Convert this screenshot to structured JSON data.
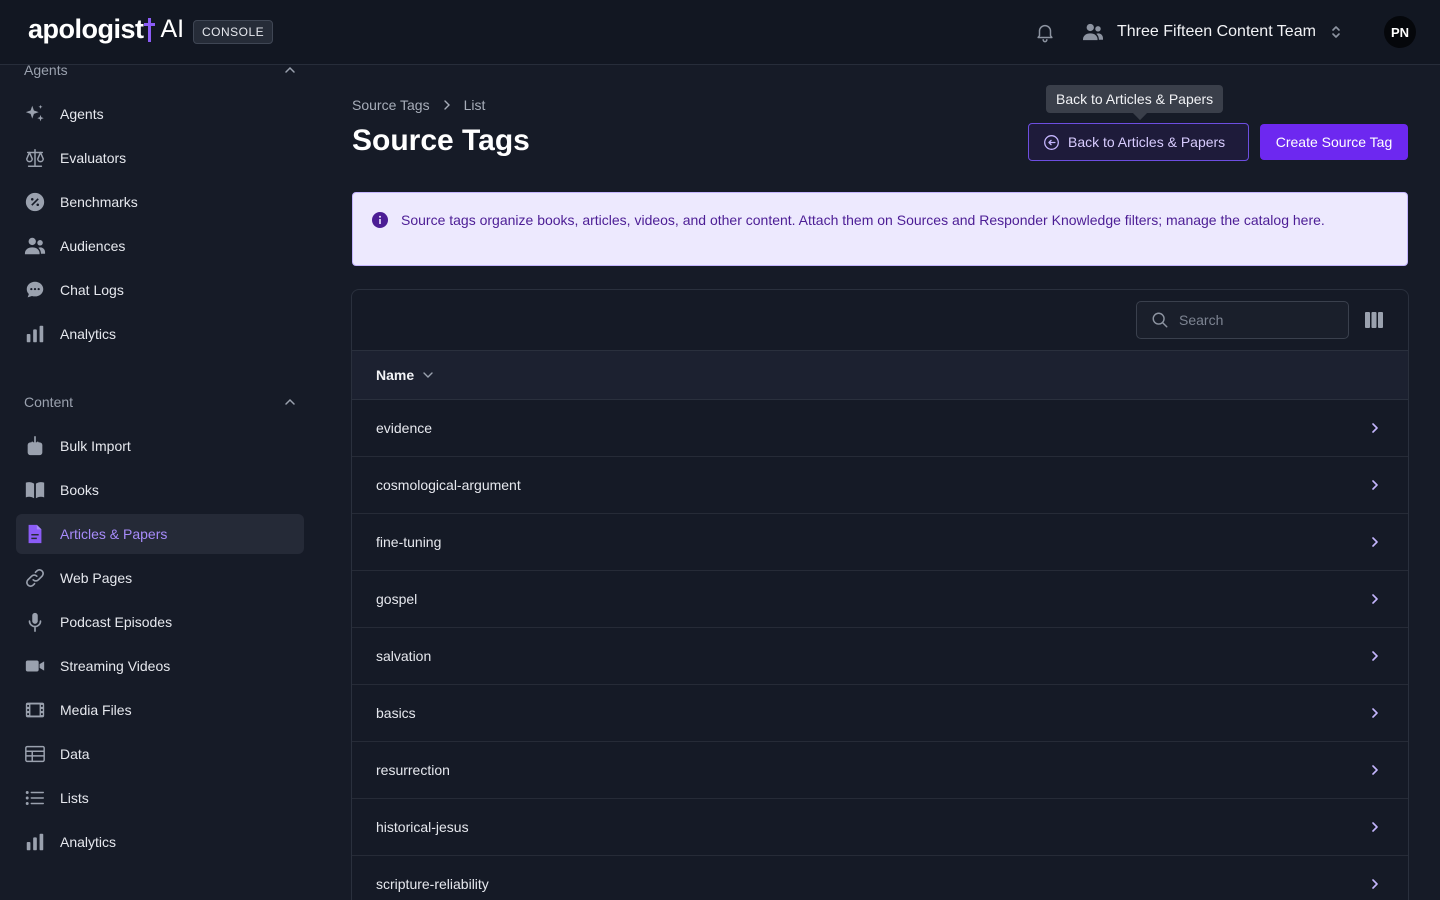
{
  "header": {
    "logo_text": "apologist",
    "logo_suffix": "AI",
    "console_badge": "CONSOLE",
    "team_name": "Three Fifteen Content Team",
    "avatar_initials": "PN"
  },
  "sidebar": {
    "agents_section": {
      "label": "Agents",
      "items": [
        {
          "label": "Agents",
          "icon": "sparkles-icon"
        },
        {
          "label": "Evaluators",
          "icon": "scale-icon"
        },
        {
          "label": "Benchmarks",
          "icon": "percent-badge-icon"
        },
        {
          "label": "Audiences",
          "icon": "users-icon"
        },
        {
          "label": "Chat Logs",
          "icon": "chat-bubble-icon"
        },
        {
          "label": "Analytics",
          "icon": "bar-chart-icon"
        }
      ]
    },
    "content_section": {
      "label": "Content",
      "items": [
        {
          "label": "Bulk Import",
          "icon": "bulk-import-icon"
        },
        {
          "label": "Books",
          "icon": "book-icon"
        },
        {
          "label": "Articles & Papers",
          "icon": "document-icon",
          "active": true
        },
        {
          "label": "Web Pages",
          "icon": "link-icon"
        },
        {
          "label": "Podcast Episodes",
          "icon": "microphone-icon"
        },
        {
          "label": "Streaming Videos",
          "icon": "video-camera-icon"
        },
        {
          "label": "Media Files",
          "icon": "film-icon"
        },
        {
          "label": "Data",
          "icon": "table-icon"
        },
        {
          "label": "Lists",
          "icon": "list-icon"
        },
        {
          "label": "Analytics",
          "icon": "bar-chart-icon"
        }
      ]
    }
  },
  "breadcrumb": {
    "parent": "Source Tags",
    "current": "List"
  },
  "page": {
    "title": "Source Tags",
    "tooltip": "Back to Articles & Papers",
    "back_button": "Back to Articles & Papers",
    "create_button": "Create Source Tag"
  },
  "info": {
    "text": "Source tags organize books, articles, videos, and other content. Attach them on Sources and Responder Knowledge filters; manage the catalog here."
  },
  "table": {
    "search_placeholder": "Search",
    "column_header": "Name",
    "rows": [
      "evidence",
      "cosmological-argument",
      "fine-tuning",
      "gospel",
      "salvation",
      "basics",
      "resurrection",
      "historical-jesus",
      "scripture-reliability"
    ]
  },
  "colors": {
    "accent": "#6d28f0",
    "active_nav_text": "#a78bfa",
    "info_background": "#ede9fe",
    "info_text": "#4c1d95"
  }
}
